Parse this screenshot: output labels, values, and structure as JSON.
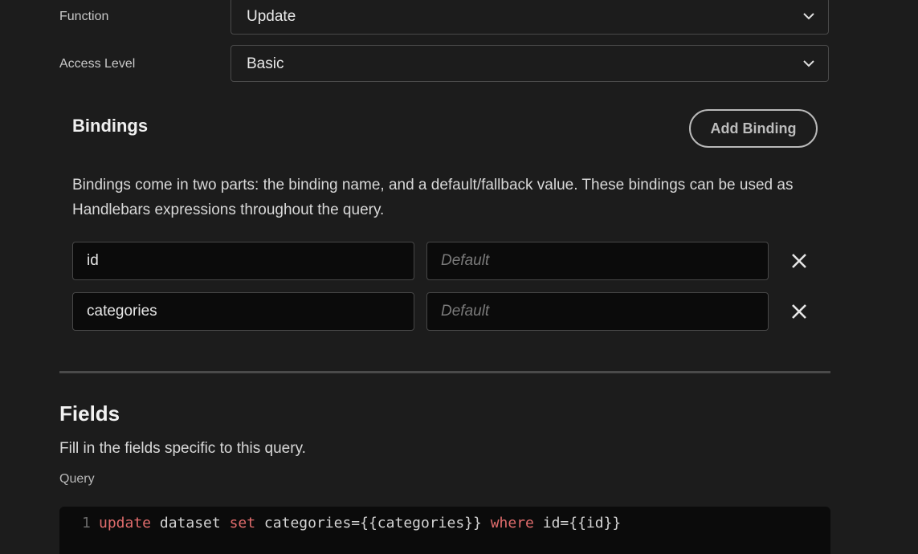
{
  "form": {
    "function": {
      "label": "Function",
      "value": "Update"
    },
    "access_level": {
      "label": "Access Level",
      "value": "Basic"
    }
  },
  "bindings": {
    "title": "Bindings",
    "add_label": "Add Binding",
    "description": "Bindings come in two parts: the binding name, and a default/fallback value. These bindings can be used as Handlebars expressions throughout the query.",
    "items": [
      {
        "name": "id",
        "default_placeholder": "Default"
      },
      {
        "name": "categories",
        "default_placeholder": "Default"
      }
    ]
  },
  "fields": {
    "title": "Fields",
    "description": "Fill in the fields specific to this query.",
    "query_label": "Query"
  },
  "editor": {
    "line_number": "1",
    "tokens": {
      "kw_update": "update",
      "t1": " dataset ",
      "kw_set": "set",
      "t2": " categories={{categories}} ",
      "kw_where": "where",
      "t3": " id={{id}}"
    }
  },
  "icons": {
    "select_chevron": "chevron-down-icon",
    "remove_binding": "close-icon"
  },
  "colors": {
    "background": "#1c1c1c",
    "input_background": "#0b0b0b",
    "keyword": "#e06c6c"
  }
}
